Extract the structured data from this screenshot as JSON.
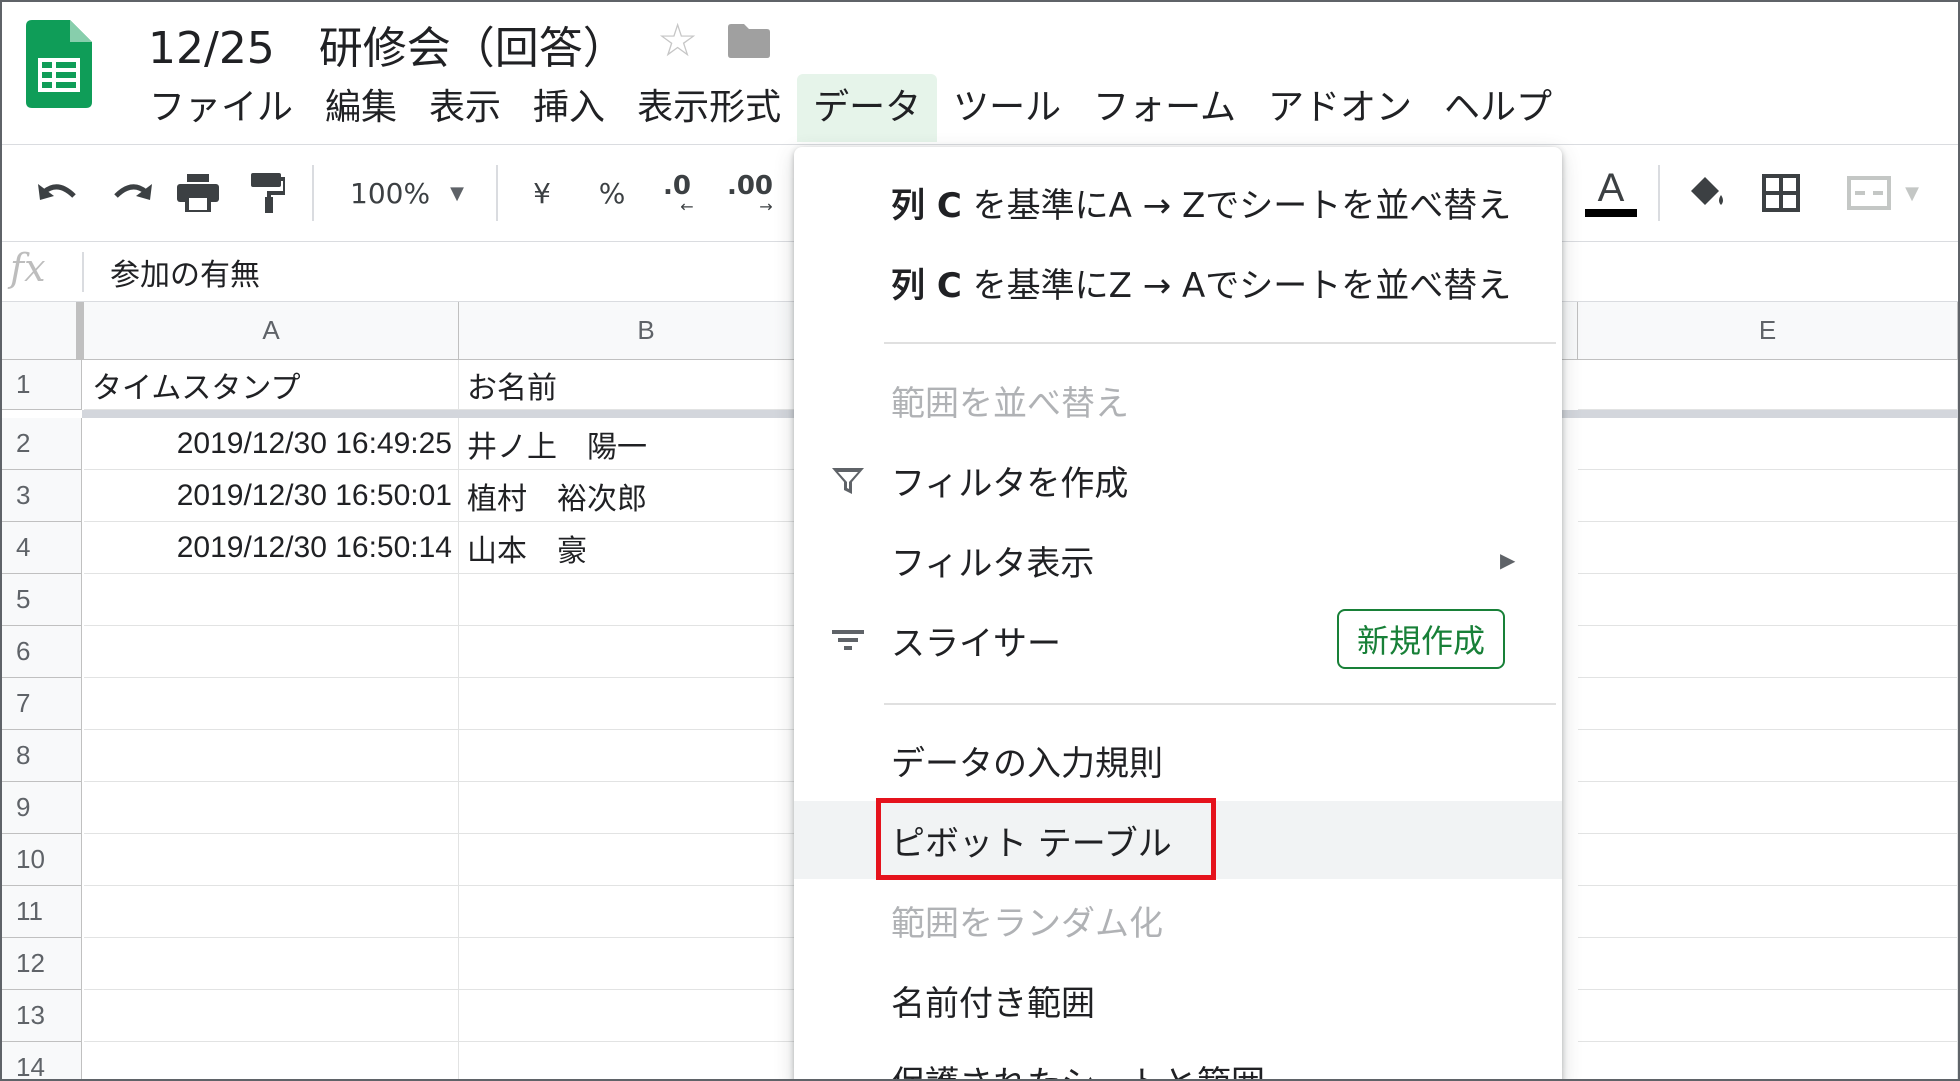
{
  "app": {
    "title": "12/25　研修会（回答）",
    "logo_icon": "google-sheets-logo",
    "accent": "#0f9d58"
  },
  "menubar": {
    "items": [
      "ファイル",
      "編集",
      "表示",
      "挿入",
      "表示形式",
      "データ",
      "ツール",
      "フォーム",
      "アドオン",
      "ヘルプ"
    ],
    "active": "データ"
  },
  "toolbar": {
    "zoom": "100%",
    "currency": "¥",
    "percent": "%",
    "decimal_decrease": ".0",
    "decimal_increase": ".00",
    "text_color_letter": "A",
    "icons": [
      "undo-icon",
      "redo-icon",
      "print-icon",
      "paint-format-icon",
      "zoom-dropdown-icon",
      "text-color-icon",
      "fill-color-icon",
      "borders-icon",
      "merge-cells-icon"
    ]
  },
  "formula_bar": {
    "fx": "fx",
    "content": "参加の有無"
  },
  "grid": {
    "columns": [
      "A",
      "B",
      "E"
    ],
    "rows": [
      "1",
      "2",
      "3",
      "4",
      "5",
      "6",
      "7",
      "8",
      "9",
      "10",
      "11",
      "12",
      "13",
      "14"
    ],
    "cells": {
      "a1": "タイムスタンプ",
      "b1": "お名前",
      "a2": "2019/12/30 16:49:25",
      "b2": "井ノ上　陽一",
      "a3": "2019/12/30 16:50:01",
      "b3": "植村　裕次郎",
      "a4": "2019/12/30 16:50:14",
      "b4": "山本　豪"
    }
  },
  "data_menu": {
    "sort_az": {
      "col": "列 C",
      "rest": " を基準にA → Zでシートを並べ替え"
    },
    "sort_za": {
      "col": "列 C",
      "rest": " を基準にZ → Aでシートを並べ替え"
    },
    "sort_range": "範囲を並べ替え",
    "create_filter": "フィルタを作成",
    "filter_views": "フィルタ表示",
    "slicer": "スライサー",
    "slicer_badge": "新規作成",
    "data_validation": "データの入力規則",
    "pivot_table": "ピボット テーブル",
    "randomize_range": "範囲をランダム化",
    "named_ranges": "名前付き範囲",
    "protected_sheets": "保護されたシートと範囲",
    "submenu_arrow": "▶",
    "highlight_color": "#e5121c"
  }
}
